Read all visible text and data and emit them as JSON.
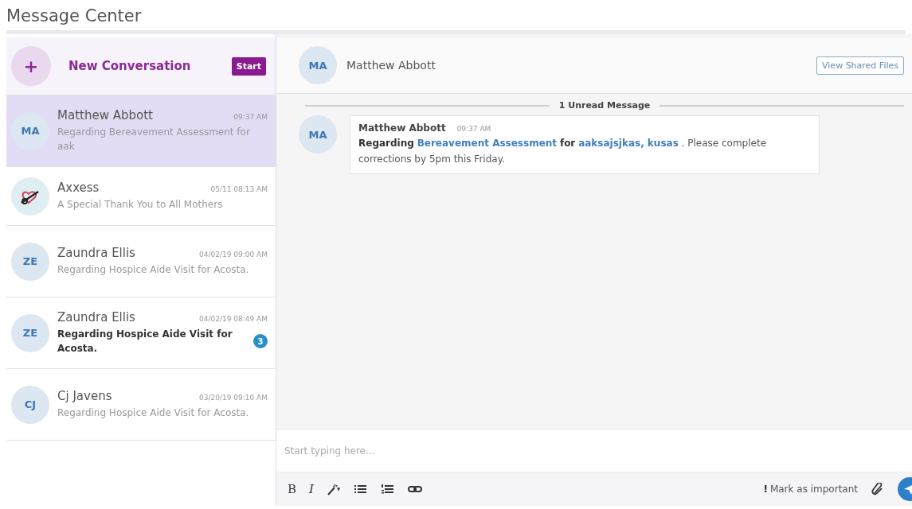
{
  "page_title": "Message Center",
  "new_conversation": {
    "label": "New Conversation",
    "icon": "+",
    "button": "Start"
  },
  "conversations": [
    {
      "avatar": {
        "kind": "initials",
        "text": "MA"
      },
      "name": "Matthew Abbott",
      "time": "09:37 AM",
      "preview": "Regarding Bereavement Assessment for aak",
      "selected": true,
      "unread": false
    },
    {
      "avatar": {
        "kind": "logo"
      },
      "name": "Axxess",
      "time": "05/11 08:13 AM",
      "preview": "A Special Thank You to All Mothers",
      "selected": false,
      "unread": false
    },
    {
      "avatar": {
        "kind": "initials",
        "text": "ZE"
      },
      "name": "Zaundra Ellis",
      "time": "04/02/19 09:00 AM",
      "preview": "Regarding Hospice Aide Visit for Acosta.",
      "selected": false,
      "unread": false
    },
    {
      "avatar": {
        "kind": "initials",
        "text": "ZE"
      },
      "name": "Zaundra Ellis",
      "time": "04/02/19 08:49 AM",
      "preview": "Regarding Hospice Aide Visit for Acosta.",
      "selected": false,
      "unread": true,
      "badge": "3"
    },
    {
      "avatar": {
        "kind": "initials",
        "text": "CJ"
      },
      "name": "Cj Javens",
      "time": "03/20/19 09:10 AM",
      "preview": "Regarding Hospice Aide Visit for Acosta.",
      "selected": false,
      "unread": false
    }
  ],
  "chat": {
    "avatar": "MA",
    "name": "Matthew Abbott",
    "shared_files_button": "View Shared Files",
    "unread_divider": "1 Unread Message",
    "messages": [
      {
        "avatar": "MA",
        "sender": "Matthew Abbott",
        "time": "09:37 AM",
        "parts": [
          {
            "kind": "bold",
            "text": "Regarding"
          },
          {
            "kind": "link",
            "text": "Bereavement Assessment"
          },
          {
            "kind": "bold",
            "text": "for"
          },
          {
            "kind": "link",
            "text": "aaksajsjkas, kusas"
          },
          {
            "kind": "plain",
            "text": ". Please complete corrections by 5pm this Friday."
          }
        ]
      }
    ]
  },
  "composer": {
    "placeholder": "Start typing here...",
    "bold_button": "B",
    "italic_button": "I",
    "important_icon": "!",
    "important_label": "Mark as important"
  }
}
